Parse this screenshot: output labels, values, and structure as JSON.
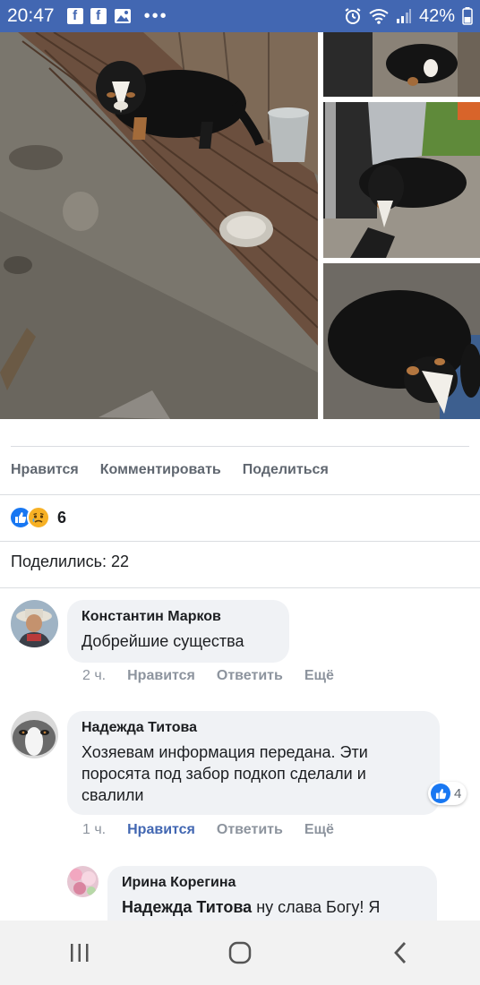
{
  "status_bar": {
    "time": "20:47",
    "battery": "42%",
    "icons": [
      "facebook-icon",
      "facebook-icon",
      "gallery-icon",
      "more-icon",
      "alarm-icon",
      "wifi-icon",
      "signal-icon",
      "battery-icon"
    ]
  },
  "actions": {
    "like": "Нравится",
    "comment": "Комментировать",
    "share": "Поделиться"
  },
  "reactions": {
    "count": "6",
    "types": [
      "like",
      "sad"
    ]
  },
  "shares": "Поделились: 22",
  "comments": [
    {
      "author": "Константин Марков",
      "text": "Добрейшие существа",
      "time": "2 ч.",
      "like": "Нравится",
      "reply": "Ответить",
      "more": "Ещё"
    },
    {
      "author": "Надежда Титова",
      "text": "Хозяевам информация передана. Эти поросята под забор подкоп сделали и свалили",
      "time": "1 ч.",
      "like": "Нравится",
      "reply": "Ответить",
      "more": "Ещё",
      "reactions": "4"
    }
  ],
  "reply": {
    "author": "Ирина Корегина",
    "mention": "Надежда Титова",
    "text": "ну слава Богу! Я"
  },
  "colors": {
    "brand": "#4267b2",
    "like_active": "#4267b2",
    "bubble": "#f0f2f5"
  }
}
